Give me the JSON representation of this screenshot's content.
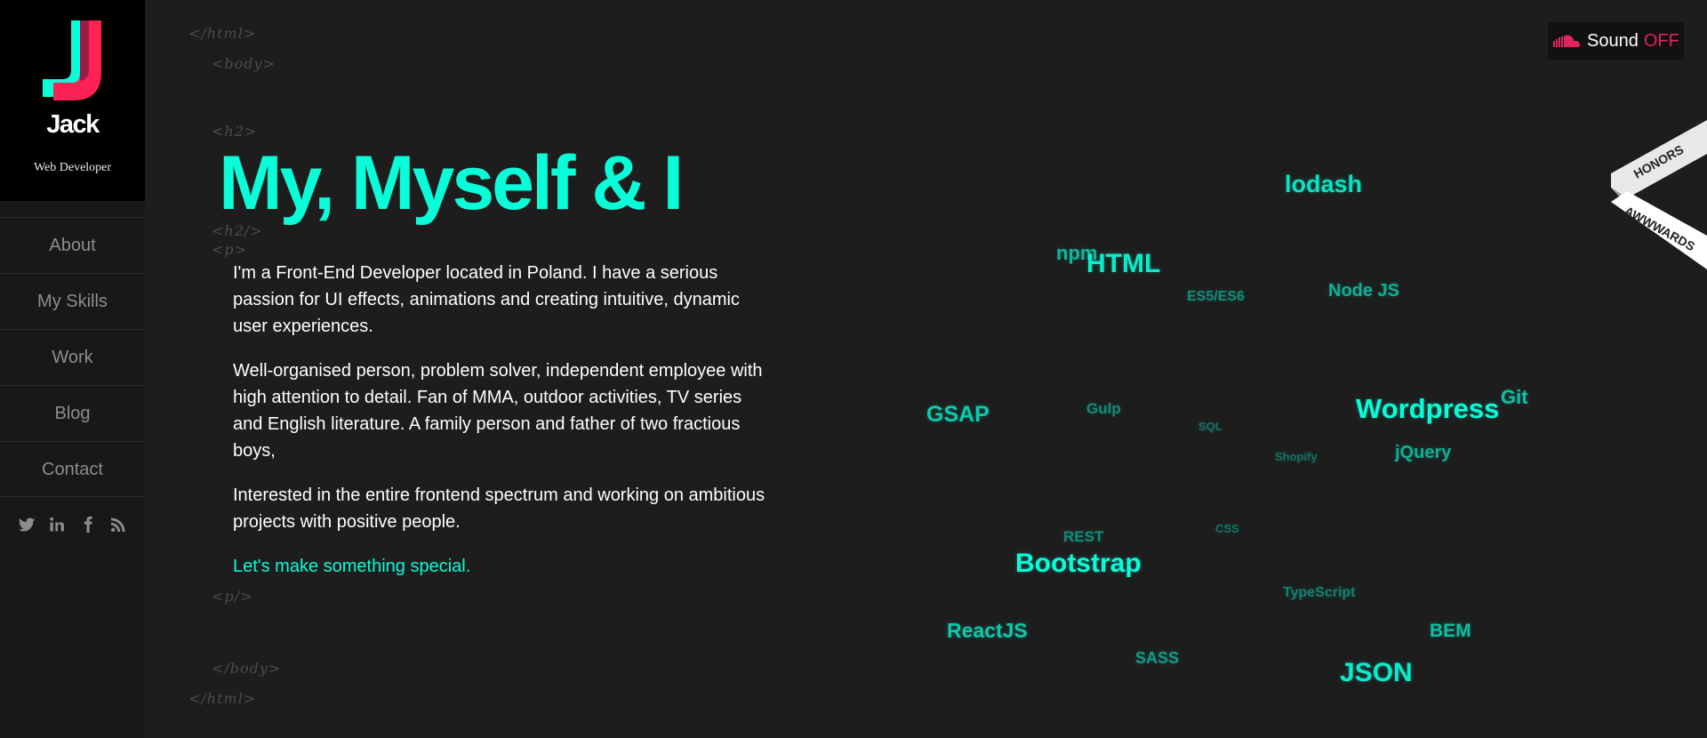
{
  "sidebar": {
    "logo_letter": "J",
    "name": "Jack",
    "tagline": "Web Developer",
    "nav": [
      {
        "label": "About"
      },
      {
        "label": "My Skills"
      },
      {
        "label": "Work"
      },
      {
        "label": "Blog"
      },
      {
        "label": "Contact"
      }
    ],
    "social_icons": [
      "twitter-icon",
      "linkedin-icon",
      "facebook-icon",
      "rss-icon"
    ]
  },
  "code_tags": {
    "html_close_top": "</html>",
    "body_open": "<body>",
    "h2_open": "<h2>",
    "h2_close": "<h2/>",
    "p_open": "<p>",
    "p_close": "<p/>",
    "body_close": "</body>",
    "html_close_bottom": "</html>"
  },
  "hero": {
    "title": "My, Myself & I",
    "paragraphs": [
      "I'm a Front-End Developer located in Poland. I have a serious passion for UI effects, animations and creating intuitive, dynamic user experiences.",
      "Well-organised person, problem solver, independent employee with high attention to detail. Fan of MMA, outdoor activities, TV series and English literature. A family person and father of two fractious boys,",
      "Interested in the entire frontend spectrum and working on ambitious projects with positive people."
    ],
    "cta": "Let's make something special."
  },
  "sound": {
    "label": "Sound",
    "state": "OFF",
    "icon": "soundcloud-icon",
    "state_color": "#e0245e"
  },
  "badge": {
    "top_text": "HONORS",
    "bottom_text": "AWWWARDS"
  },
  "colors": {
    "accent": "#08fdd8",
    "brand_pink": "#fd2155",
    "background": "#1d1d1d",
    "sidebar": "#181818"
  },
  "skills": [
    {
      "label": "lodash",
      "emphasis": 0.85
    },
    {
      "label": "npm",
      "emphasis": 0.6
    },
    {
      "label": "HTML",
      "emphasis": 0.9
    },
    {
      "label": "ES5/ES6",
      "emphasis": 0.35
    },
    {
      "label": "Node JS",
      "emphasis": 0.55
    },
    {
      "label": "GSAP",
      "emphasis": 0.7
    },
    {
      "label": "Gulp",
      "emphasis": 0.35
    },
    {
      "label": "SQL",
      "emphasis": 0.2
    },
    {
      "label": "Wordpress",
      "emphasis": 1.0
    },
    {
      "label": "Git",
      "emphasis": 0.65
    },
    {
      "label": "Shopify",
      "emphasis": 0.2
    },
    {
      "label": "jQuery",
      "emphasis": 0.55
    },
    {
      "label": "REST",
      "emphasis": 0.35
    },
    {
      "label": "CSS",
      "emphasis": 0.2
    },
    {
      "label": "Bootstrap",
      "emphasis": 1.0
    },
    {
      "label": "TypeScript",
      "emphasis": 0.3
    },
    {
      "label": "ReactJS",
      "emphasis": 0.7
    },
    {
      "label": "BEM",
      "emphasis": 0.65
    },
    {
      "label": "SASS",
      "emphasis": 0.45
    },
    {
      "label": "JSON",
      "emphasis": 0.9
    }
  ]
}
